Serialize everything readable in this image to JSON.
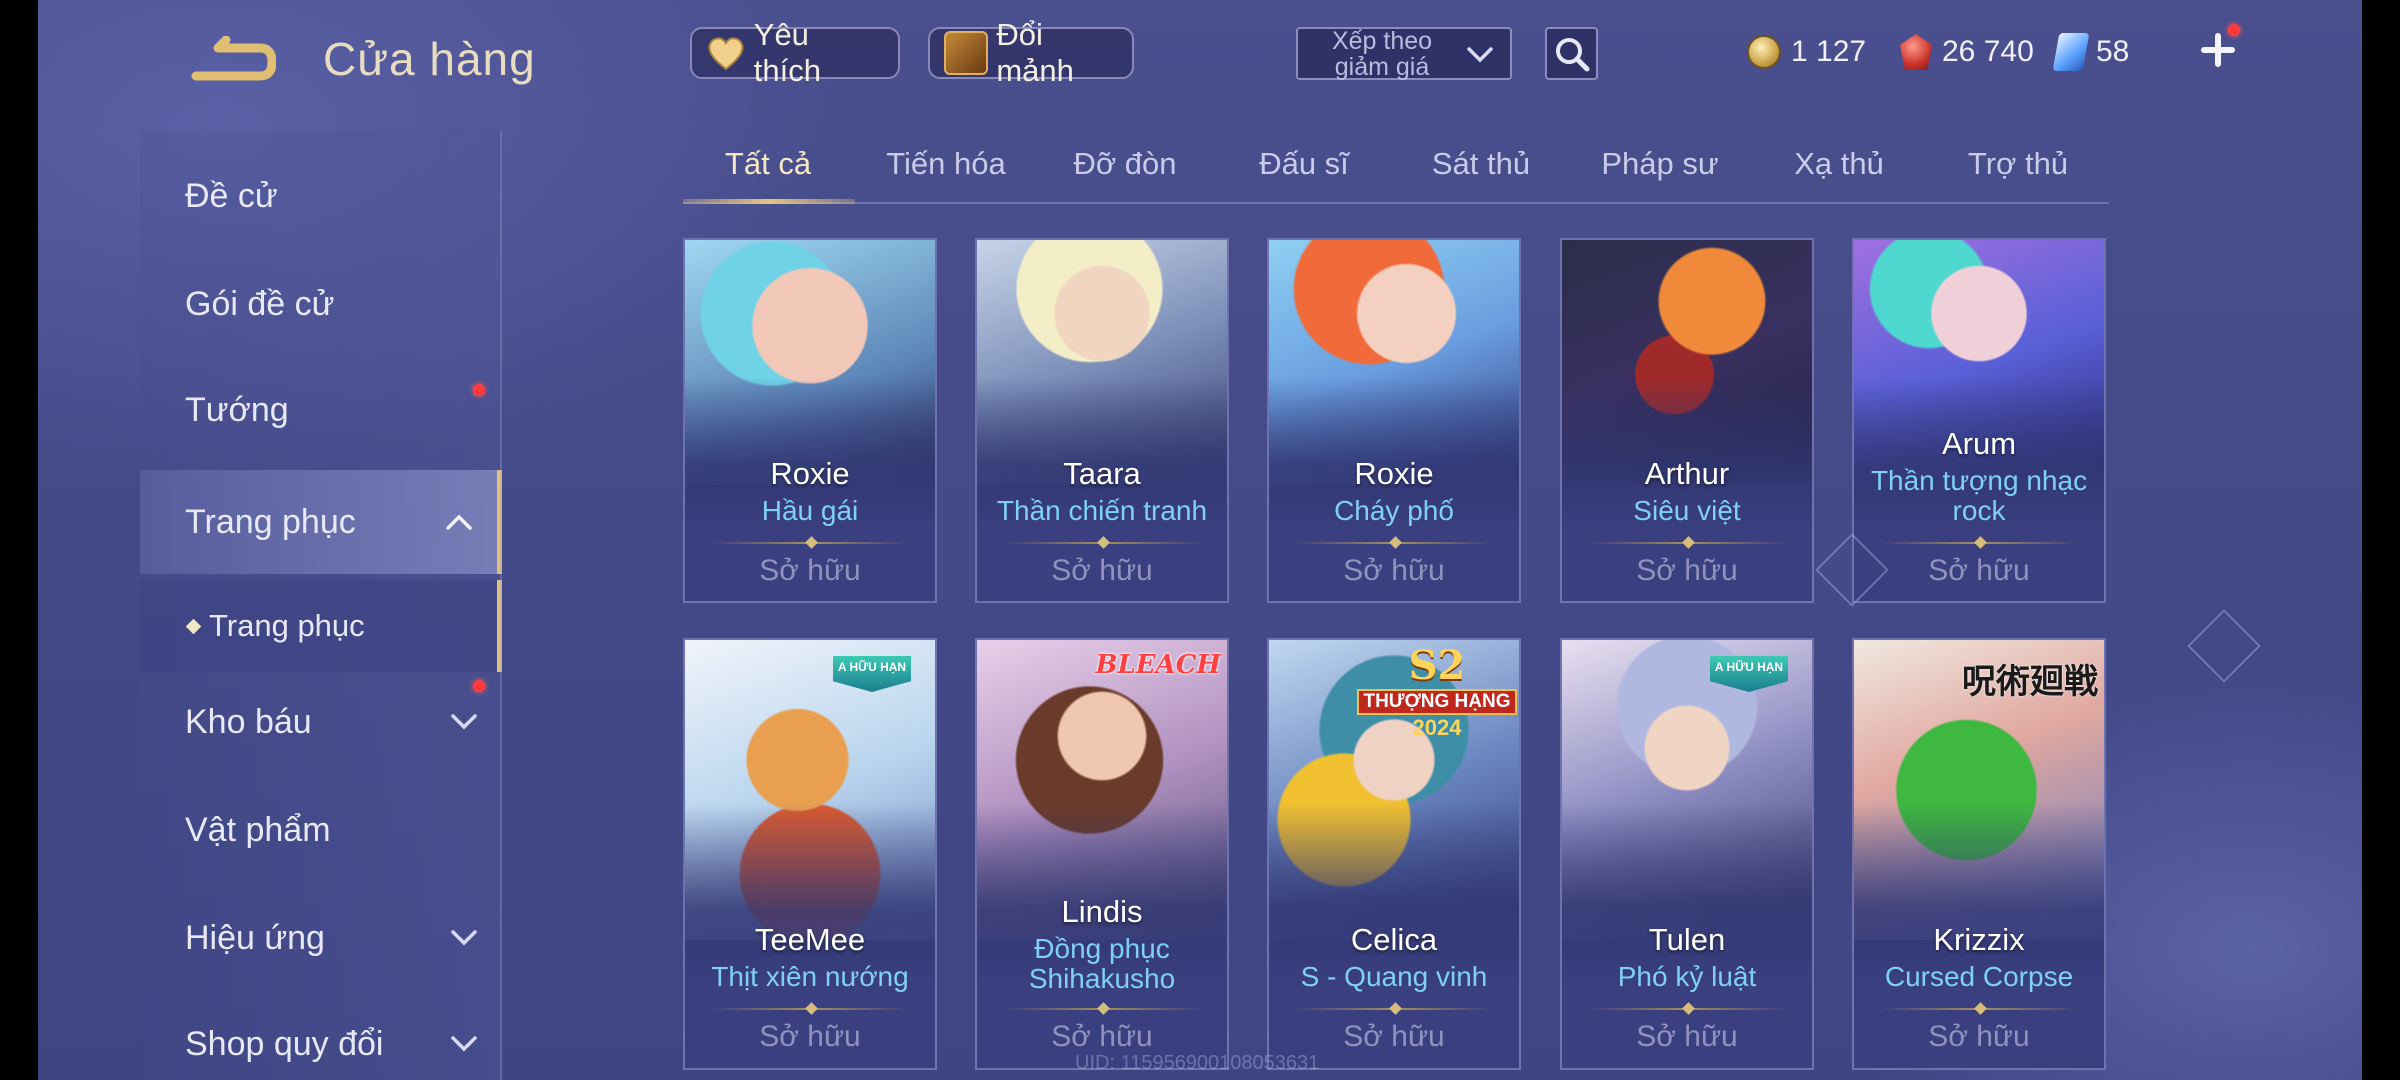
{
  "header": {
    "title": "Cửa hàng",
    "favorite_label": "Yêu thích",
    "shard_label": "Đổi mảnh",
    "sort_label": "Xếp theo giảm giá"
  },
  "currency": {
    "gold": "1 127",
    "ruby": "26 740",
    "gem": "58"
  },
  "sidebar": {
    "items": [
      {
        "label": "Đề cử"
      },
      {
        "label": "Gói đề cử"
      },
      {
        "label": "Tướng"
      },
      {
        "label": "Trang phục"
      },
      {
        "label": "Trang phục"
      },
      {
        "label": "Kho báu"
      },
      {
        "label": "Vật phẩm"
      },
      {
        "label": "Hiệu ứng"
      },
      {
        "label": "Shop quy đổi"
      }
    ]
  },
  "tabs": [
    "Tất cả",
    "Tiến hóa",
    "Đỡ đòn",
    "Đấu sĩ",
    "Sát thủ",
    "Pháp sư",
    "Xạ thủ",
    "Trợ thủ"
  ],
  "cards": [
    {
      "hero": "Roxie",
      "skin": "Hầu gái",
      "status": "Sở hữu"
    },
    {
      "hero": "Taara",
      "skin": "Thần chiến tranh",
      "status": "Sở hữu"
    },
    {
      "hero": "Roxie",
      "skin": "Cháy phố",
      "status": "Sở hữu"
    },
    {
      "hero": "Arthur",
      "skin": "Siêu việt",
      "status": "Sở hữu"
    },
    {
      "hero": "Arum",
      "skin": "Thần tượng nhạc rock",
      "status": "Sở hữu"
    },
    {
      "hero": "TeeMee",
      "skin": "Thịt xiên nướng",
      "status": "Sở hữu",
      "badge": "A HỮU HẠN"
    },
    {
      "hero": "Lindis",
      "skin": "Đồng phục Shihakusho",
      "status": "Sở hữu",
      "badge": "BLEACH"
    },
    {
      "hero": "Celica",
      "skin": "S - Quang vinh",
      "status": "Sở hữu",
      "badge_s2": "S2",
      "badge_rank": "THƯỢNG HẠNG",
      "badge_year": "2024"
    },
    {
      "hero": "Tulen",
      "skin": "Phó kỷ luật",
      "status": "Sở hữu",
      "badge": "A HỮU HẠN"
    },
    {
      "hero": "Krizzix",
      "skin": "Cursed Corpse",
      "status": "Sở hữu",
      "badge": "呪術廻戦"
    }
  ],
  "uid": "UID: 115956900108053631"
}
